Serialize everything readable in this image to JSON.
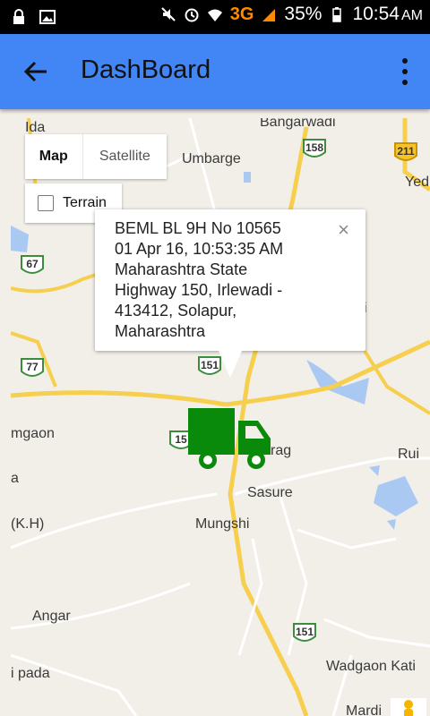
{
  "status_bar": {
    "network": "3G",
    "battery": "35%",
    "time": "10:54",
    "ampm": "AM",
    "icons": [
      "lock-icon",
      "image-icon",
      "mute-icon",
      "alarm-icon",
      "wifi-icon",
      "signal-icon",
      "battery-icon"
    ]
  },
  "app_bar": {
    "title": "DashBoard",
    "color": "#4285f4",
    "icons": [
      "back-arrow-icon",
      "more-vert-icon"
    ]
  },
  "map": {
    "controls": {
      "map_label": "Map",
      "satellite_label": "Satellite",
      "terrain_label": "Terrain",
      "terrain_checked": false
    },
    "info_window": {
      "lines": [
        "BEML BL 9H No 10565",
        "01 Apr 16, 10:53:35 AM",
        "Maharashtra State",
        "Highway 150, Irlewadi -",
        "413412, Solapur,",
        "Maharashtra"
      ],
      "close_label": "×"
    },
    "places": {
      "ida": "Ida",
      "bangarwadi": "Bangarwadi",
      "umbarge": "Umbarge",
      "yed": "Yed",
      "i": "i",
      "mgaon": "mgaon",
      "rag": "rag",
      "rui": "Rui",
      "a": "a",
      "sasure": "Sasure",
      "kh": "(K.H)",
      "mungshi": "Mungshi",
      "angar": "Angar",
      "ipada": "i pada",
      "wadgaon": "Wadgaon Kati",
      "mardi": "Mardi"
    },
    "highways": {
      "h158": "158",
      "h211": "211",
      "h67": "67",
      "h77": "77",
      "h151a": "151",
      "h15": "15",
      "h151b": "151"
    },
    "marker_color": "#0a8a0a"
  }
}
